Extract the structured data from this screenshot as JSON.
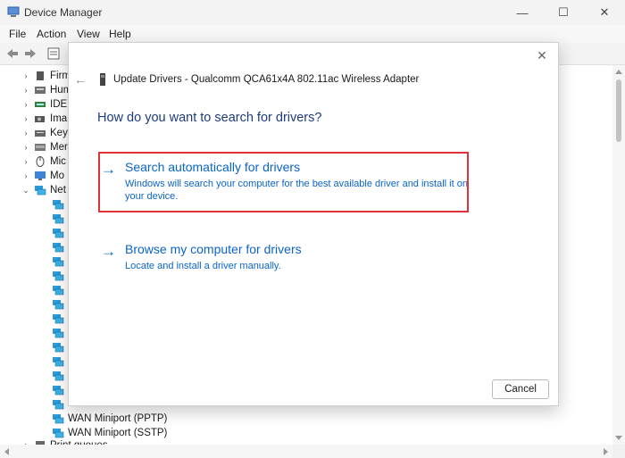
{
  "window": {
    "title": "Device Manager",
    "minimize": "—",
    "maximize": "☐",
    "close": "✕"
  },
  "menu": [
    "File",
    "Action",
    "View",
    "Help"
  ],
  "tree": {
    "items": [
      {
        "label": "Firm",
        "icon": "firmware-icon",
        "expanded": false
      },
      {
        "label": "Hum",
        "icon": "hid-icon",
        "expanded": false
      },
      {
        "label": "IDE",
        "icon": "ide-icon",
        "expanded": false
      },
      {
        "label": "Ima",
        "icon": "imaging-icon",
        "expanded": false
      },
      {
        "label": "Key",
        "icon": "keyboard-icon",
        "expanded": false
      },
      {
        "label": "Mer",
        "icon": "memory-icon",
        "expanded": false
      },
      {
        "label": "Mic",
        "icon": "mouse-icon",
        "expanded": false
      },
      {
        "label": "Mo",
        "icon": "monitor-icon",
        "expanded": false
      },
      {
        "label": "Net",
        "icon": "network-icon",
        "expanded": true
      }
    ],
    "network_children": [
      "WAN Miniport (PPTP)",
      "WAN Miniport (SSTP)"
    ],
    "bottom_item": "Print queues"
  },
  "dialog": {
    "title": "Update Drivers - Qualcomm QCA61x4A 802.11ac Wireless Adapter",
    "question": "How do you want to search for drivers?",
    "options": [
      {
        "arrow": "→",
        "title": "Search automatically for drivers",
        "description": "Windows will search your computer for the best available driver and install it on your device."
      },
      {
        "arrow": "→",
        "title": "Browse my computer for drivers",
        "description": "Locate and install a driver manually."
      }
    ],
    "cancel": "Cancel",
    "close": "✕",
    "back": "←"
  },
  "colors": {
    "link": "#0a64c8",
    "question": "#1e3c7b",
    "highlight": "#e0323b"
  }
}
